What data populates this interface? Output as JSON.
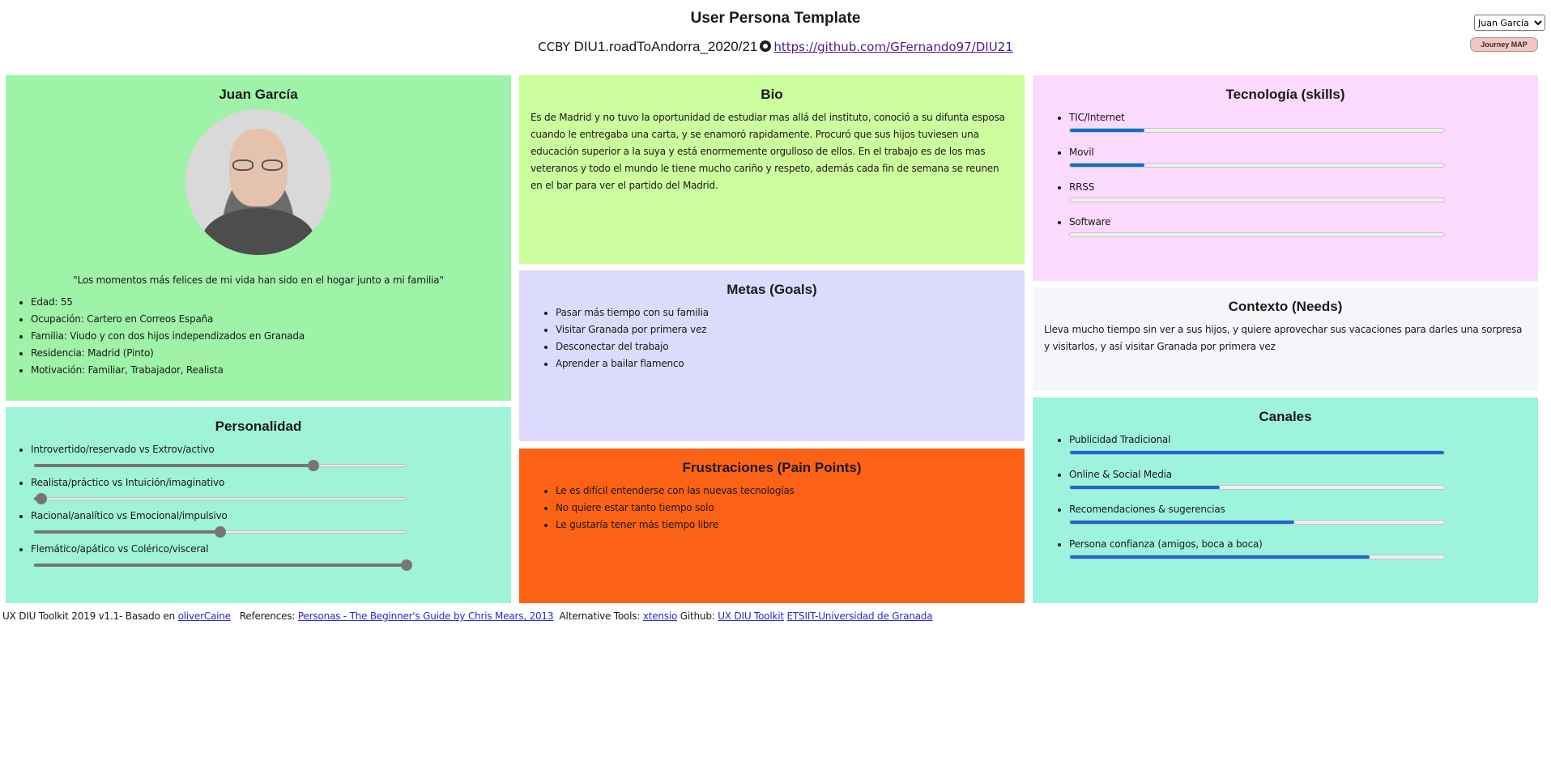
{
  "header": {
    "title": "User Persona Template",
    "license_prefix": "CCBY",
    "license_name": "DIU1.roadToAndorra_2020/21",
    "repo_link": "https://github.com/GFernando97/DIU21",
    "persona_select": "Juan García",
    "journey_button": "Journey MAP"
  },
  "persona": {
    "name": "Juan García",
    "quote": "\"Los momentos más felices de mi vida han sido en el hogar junto a mi familia\"",
    "details": [
      "Edad: 55",
      "Ocupación: Cartero en Correos España",
      "Familia: Viudo y con dos hijos independizados en Granada",
      "Residencia: Madrid (Pinto)",
      "Motivación: Familiar, Trabajador, Realista"
    ]
  },
  "personality": {
    "title": "Personalidad",
    "traits": [
      {
        "label": "Introvertido/reservado vs Extrov/activo",
        "value": 75
      },
      {
        "label": "Realista/práctico vs Intuición/imaginativo",
        "value": 2
      },
      {
        "label": "Racional/analítico vs Emocional/impulsivo",
        "value": 50
      },
      {
        "label": "Flemático/apático vs Colérico/visceral",
        "value": 100
      }
    ]
  },
  "bio": {
    "title": "Bio",
    "text": "Es de Madrid y no tuvo la oportunidad de estudiar mas allá del instituto, conoció a su difunta esposa cuando le entregaba una carta, y se enamoró rapidamente. Procuró que sus hijos tuviesen una educación superior a la suya y está enormemente orgulloso de ellos. En el trabajo es de los mas veteranos y todo el mundo le tiene mucho cariño y respeto, además cada fin de semana se reunen en el bar para ver el partido del Madrid."
  },
  "goals": {
    "title": "Metas (Goals)",
    "items": [
      "Pasar más tiempo con su familia",
      "Visitar Granada por primera vez",
      "Desconectar del trabajo",
      "Aprender a bailar flamenco"
    ]
  },
  "frustrations": {
    "title": "Frustraciones (Pain Points)",
    "items": [
      "Le es difícil entenderse con las nuevas tecnologías",
      "No quiere estar tanto tiempo solo",
      "Le gustaría tener más tiempo libre"
    ]
  },
  "skills": {
    "title": "Tecnología (skills)",
    "items": [
      {
        "label": "TIC/Internet",
        "value": 20
      },
      {
        "label": "Movil",
        "value": 20
      },
      {
        "label": "RRSS",
        "value": 0
      },
      {
        "label": "Software",
        "value": 0
      }
    ]
  },
  "context": {
    "title": "Contexto (Needs)",
    "text": "Lleva mucho tiempo sin ver a sus hijos, y quiere aprovechar sus vacaciones para darles una sorpresa y visitarlos, y así visitar Granada por primera vez"
  },
  "channels": {
    "title": "Canales",
    "items": [
      {
        "label": "Publicidad Tradicional",
        "value": 100
      },
      {
        "label": "Online & Social Media",
        "value": 40
      },
      {
        "label": "Recomendaciones & sugerencias",
        "value": 60
      },
      {
        "label": "Persona confianza (amigos, boca a boca)",
        "value": 80
      }
    ]
  },
  "footer": {
    "toolkit": "UX DIU Toolkit 2019 v1.1- Basado en",
    "oliver_link": "oliverCaine",
    "references_label": "References:",
    "personas_link": "Personas - The Beginner's Guide by Chris Mears, 2013",
    "alt_tools_label": "Alternative Tools:",
    "xtensio_link": "xtensio",
    "github_label": "Github:",
    "toolkit_link": "UX DIU Toolkit",
    "etsiit_link": "ETSIIT-Universidad de Granada"
  },
  "colors": {
    "persona_bg": "#9ef3a8",
    "personality_bg": "#9ef3d9",
    "bio_bg": "#ccfe9d",
    "goals_bg": "#dcdbfd",
    "frustrations_bg": "#fc6215",
    "skills_bg": "#fcdafd",
    "context_bg": "#f4f6f9",
    "channels_bg": "#9ef3dc"
  }
}
